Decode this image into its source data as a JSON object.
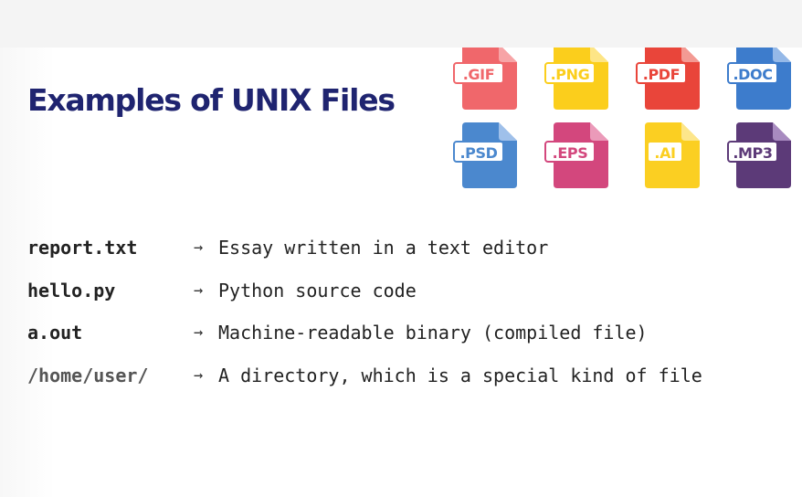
{
  "slide": {
    "title": "Examples of UNIX Files"
  },
  "file_icons": [
    {
      "label": ".GIF",
      "icon": "gif-file-icon",
      "color": "#f0676b",
      "fold": "#f7a4a6"
    },
    {
      "label": ".PNG",
      "icon": "png-file-icon",
      "color": "#fbce1c",
      "fold": "#fde586"
    },
    {
      "label": ".PDF",
      "icon": "pdf-file-icon",
      "color": "#e9453a",
      "fold": "#f39a93"
    },
    {
      "label": ".DOC",
      "icon": "doc-file-icon",
      "color": "#3d7ccc",
      "fold": "#95b9e8"
    },
    {
      "label": ".PSD",
      "icon": "psd-file-icon",
      "color": "#4b88ce",
      "fold": "#9fc0ea"
    },
    {
      "label": ".EPS",
      "icon": "eps-file-icon",
      "color": "#d3477d",
      "fold": "#eb9ab9"
    },
    {
      "label": ".AI",
      "icon": "ai-file-icon",
      "color": "#fbcf22",
      "fold": "#fde68b"
    },
    {
      "label": ".MP3",
      "icon": "mp3-file-icon",
      "color": "#5c3a78",
      "fold": "#a88bc0"
    }
  ],
  "examples": [
    {
      "name": "report.txt",
      "arrow": "→",
      "description": "Essay written in a text editor"
    },
    {
      "name": "hello.py",
      "arrow": "→",
      "description": "Python source code"
    },
    {
      "name": "a.out",
      "arrow": "→",
      "description": "Machine-readable binary (compiled file)"
    },
    {
      "name": "/home/user/",
      "arrow": "→",
      "description": "A directory, which is a special kind of file"
    }
  ]
}
